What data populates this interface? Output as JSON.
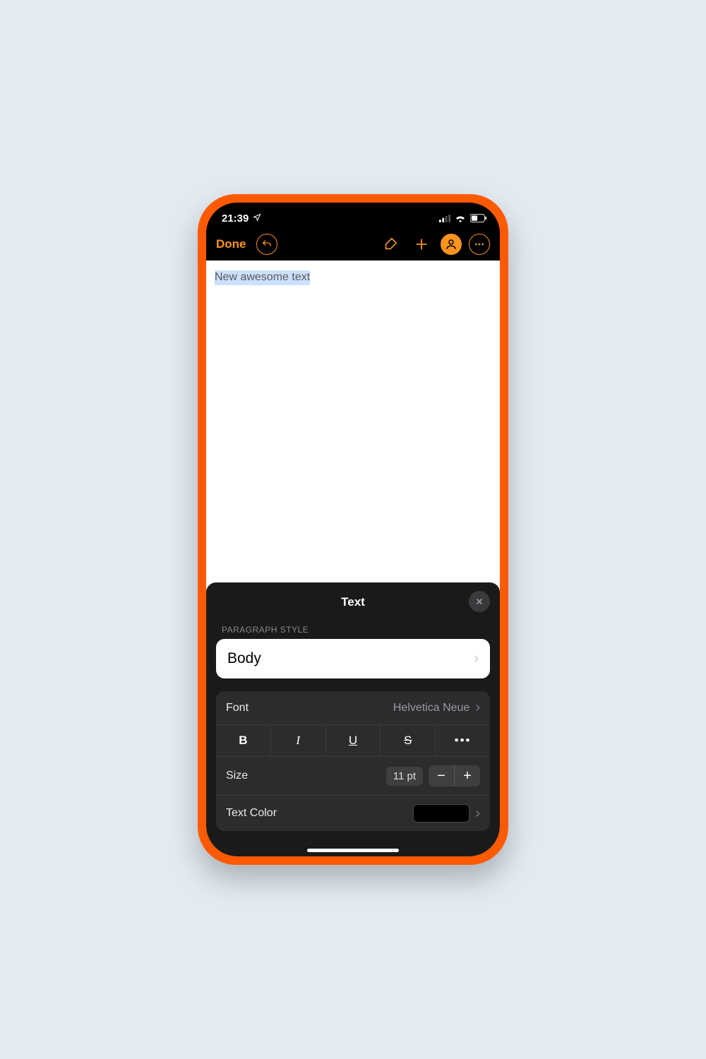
{
  "status": {
    "time": "21:39"
  },
  "toolbar": {
    "done_label": "Done"
  },
  "document": {
    "selected_text": "New awesome text"
  },
  "panel": {
    "title": "Text",
    "paragraph_section_label": "PARAGRAPH STYLE",
    "paragraph_style": "Body",
    "font_label": "Font",
    "font_value": "Helvetica Neue",
    "size_label": "Size",
    "size_value": "11 pt",
    "text_color_label": "Text Color",
    "text_color_value": "#000000",
    "format_buttons": {
      "bold": "B",
      "italic": "I",
      "underline": "U",
      "strike": "S",
      "more": "•••"
    }
  }
}
